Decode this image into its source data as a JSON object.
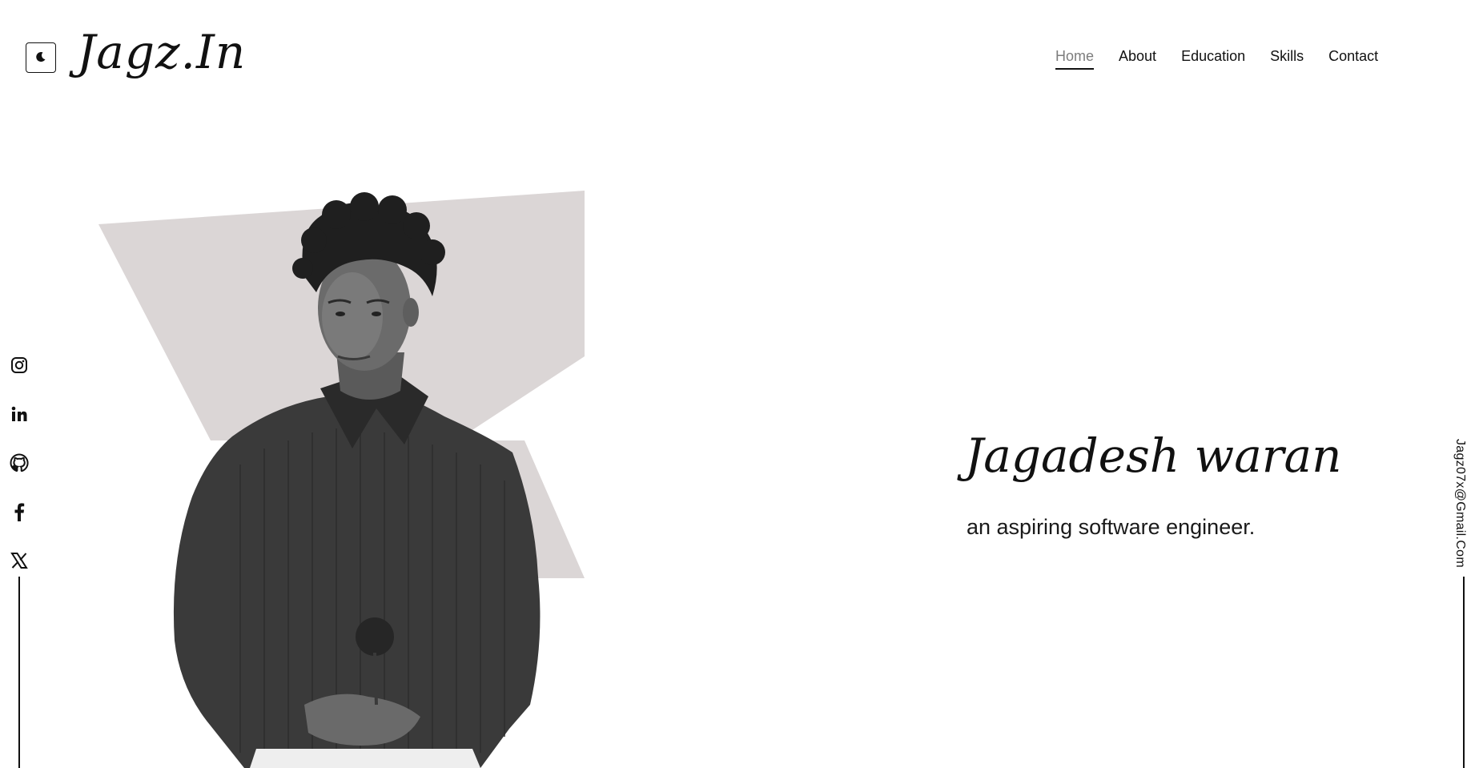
{
  "brand": {
    "logo": "Jagz.In"
  },
  "theme_toggle": {
    "icon": "moon-icon"
  },
  "nav": {
    "items": [
      "Home",
      "About",
      "Education",
      "Skills",
      "Contact"
    ],
    "active": "Home"
  },
  "socials": {
    "icons": [
      "instagram-icon",
      "linkedin-icon",
      "github-icon",
      "facebook-icon",
      "x-twitter-icon"
    ]
  },
  "hero": {
    "name": "Jagadesh waran",
    "subtitle": "an aspiring software engineer."
  },
  "contact": {
    "email": "Jagz07x@Gmail.Com"
  },
  "colors": {
    "background": "#ffffff",
    "text": "#111111",
    "shape": "#dbd6d6",
    "nav_active": "#7d7d7d"
  }
}
